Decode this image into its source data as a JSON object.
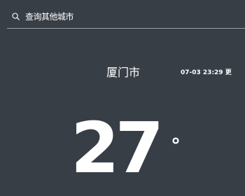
{
  "search": {
    "placeholder": "查询其他城市",
    "icon": "search-icon"
  },
  "weather": {
    "city": "厦门市",
    "update_time": "07-03 23:29 更",
    "temperature": "27",
    "temperature_unit": "°"
  },
  "colors": {
    "background": "#383e46",
    "text": "#ffffff",
    "divider": "#9aa0a6"
  }
}
